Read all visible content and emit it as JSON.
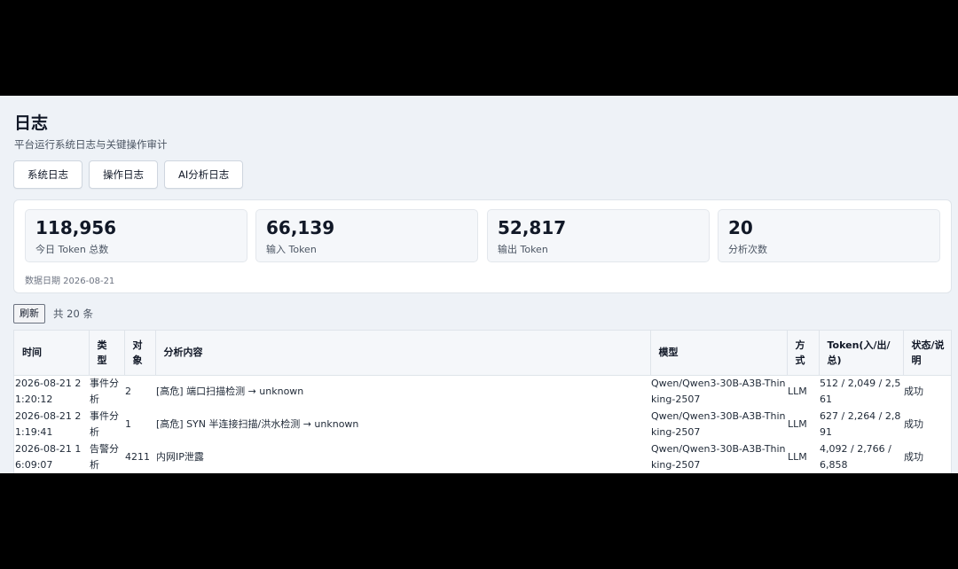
{
  "page": {
    "title": "日志",
    "subtitle": "平台运行系统日志与关键操作审计"
  },
  "tabs": [
    {
      "label": "系统日志"
    },
    {
      "label": "操作日志"
    },
    {
      "label": "AI分析日志"
    }
  ],
  "stats": [
    {
      "value": "118,956",
      "label": "今日 Token 总数"
    },
    {
      "value": "66,139",
      "label": "输入 Token"
    },
    {
      "value": "52,817",
      "label": "输出 Token"
    },
    {
      "value": "20",
      "label": "分析次数"
    }
  ],
  "data_date": "数据日期 2026-08-21",
  "toolbar": {
    "refresh_label": "刷新",
    "total_text": "共 20 条"
  },
  "table": {
    "headers": [
      "时间",
      "类型",
      "对象",
      "分析内容",
      "模型",
      "方式",
      "Token(入/出/总)",
      "状态/说明"
    ],
    "rows": [
      [
        "2026-08-21 21:20:12",
        "事件分析",
        "2",
        "[高危] 端口扫描检测 → unknown",
        "Qwen/Qwen3-30B-A3B-Thinking-2507",
        "LLM",
        "512 / 2,049 / 2,561",
        "成功"
      ],
      [
        "2026-08-21 21:19:41",
        "事件分析",
        "1",
        "[高危] SYN 半连接扫描/洪水检测 → unknown",
        "Qwen/Qwen3-30B-A3B-Thinking-2507",
        "LLM",
        "627 / 2,264 / 2,891",
        "成功"
      ],
      [
        "2026-08-21 16:09:07",
        "告警分析",
        "4211",
        "内网IP泄露",
        "Qwen/Qwen3-30B-A3B-Thinking-2507",
        "LLM",
        "4,092 / 2,766 / 6,858",
        "成功"
      ]
    ]
  }
}
